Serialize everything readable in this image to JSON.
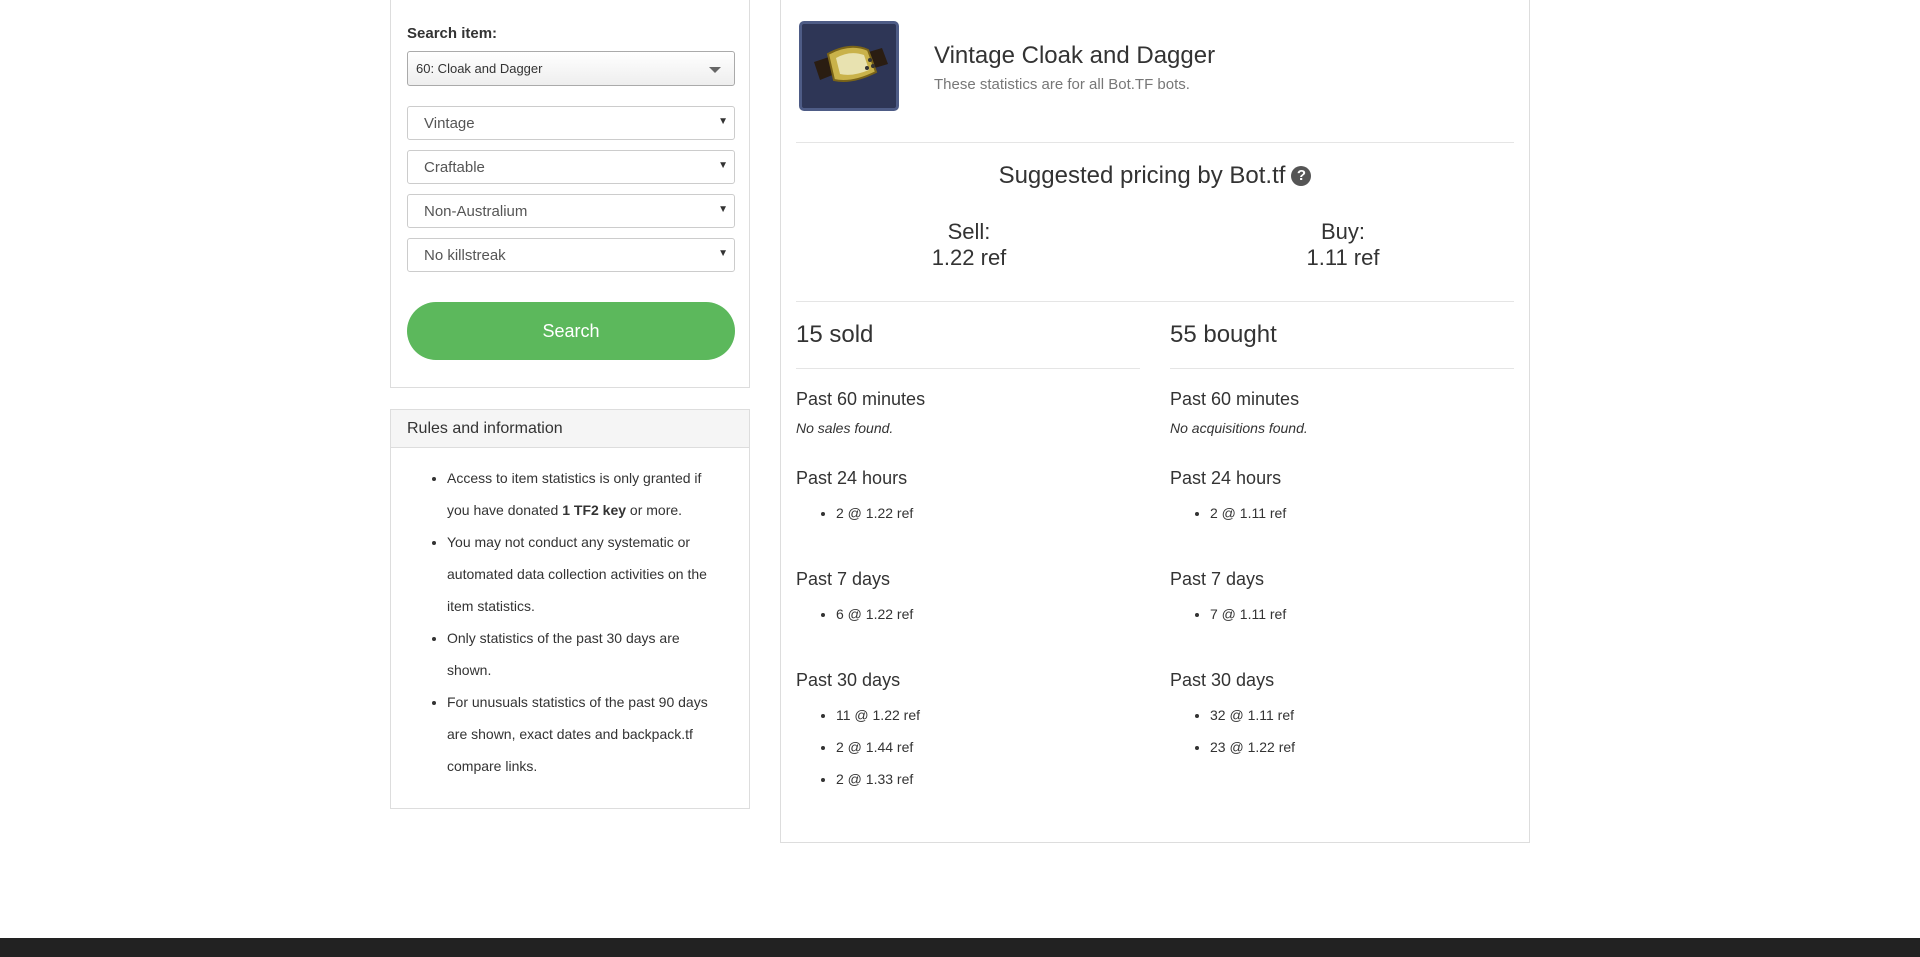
{
  "search": {
    "label": "Search item:",
    "item_value": "60: Cloak and Dagger",
    "quality": "Vintage",
    "craftable": "Craftable",
    "australium": "Non-Australium",
    "killstreak": "No killstreak",
    "button_label": "Search"
  },
  "rules": {
    "title": "Rules and information",
    "item1_pre": "Access to item statistics is only granted if you have donated ",
    "item1_bold": "1 TF2 key",
    "item1_post": " or more.",
    "item2": "You may not conduct any systematic or automated data collection activities on the item statistics.",
    "item3": "Only statistics of the past 30 days are shown.",
    "item4": "For unusuals statistics of the past 90 days are shown, exact dates and backpack.tf compare links."
  },
  "item": {
    "title": "Vintage Cloak and Dagger",
    "subtitle": "These statistics are for all Bot.TF bots.",
    "icon": "cloak-and-dagger-watch-icon"
  },
  "pricing": {
    "title": "Suggested pricing by Bot.tf",
    "help_icon": "?",
    "sell_label": "Sell:",
    "sell_value": "1.22 ref",
    "buy_label": "Buy:",
    "buy_value": "1.11 ref"
  },
  "sold": {
    "count": "15 sold",
    "p60_title": "Past 60 minutes",
    "p60_empty": "No sales found.",
    "p24_title": "Past 24 hours",
    "p24": [
      "2 @ 1.22 ref"
    ],
    "p7_title": "Past 7 days",
    "p7": [
      "6 @ 1.22 ref"
    ],
    "p30_title": "Past 30 days",
    "p30": [
      "11 @ 1.22 ref",
      "2 @ 1.44 ref",
      "2 @ 1.33 ref"
    ]
  },
  "bought": {
    "count": "55 bought",
    "p60_title": "Past 60 minutes",
    "p60_empty": "No acquisitions found.",
    "p24_title": "Past 24 hours",
    "p24": [
      "2 @ 1.11 ref"
    ],
    "p7_title": "Past 7 days",
    "p7": [
      "7 @ 1.11 ref"
    ],
    "p30_title": "Past 30 days",
    "p30": [
      "32 @ 1.11 ref",
      "23 @ 1.22 ref"
    ]
  },
  "colors": {
    "accent_green": "#5cb85c",
    "footer": "#222222",
    "icon_bg": "#2e3656"
  }
}
